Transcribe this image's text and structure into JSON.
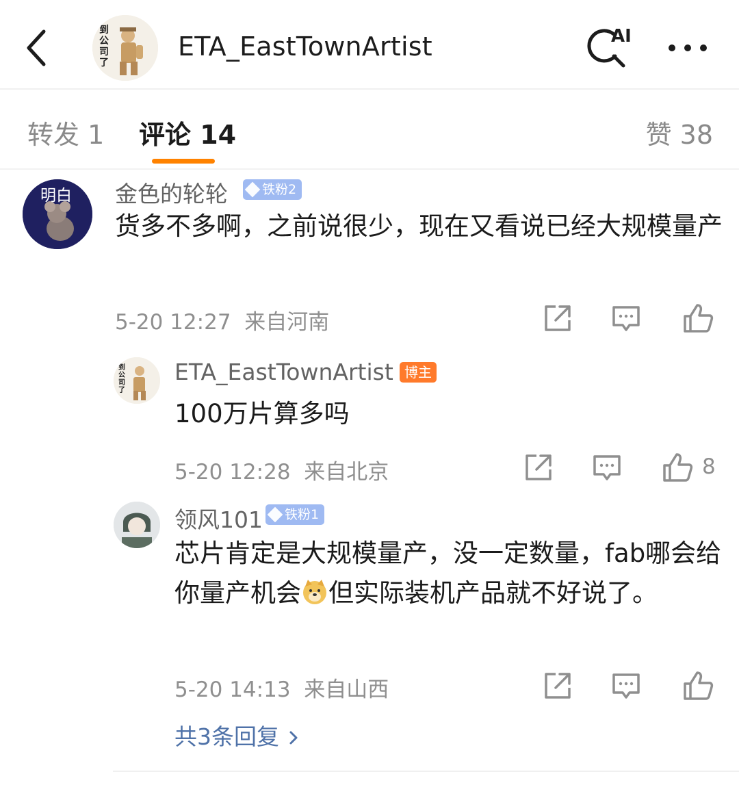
{
  "header": {
    "title": "ETA_EastTownArtist",
    "avatar_text": "到公司了",
    "ai_label": "AI",
    "icons": [
      "back-chevron-icon",
      "ai-search-icon",
      "more-dots-icon"
    ]
  },
  "tabs": {
    "repost": "转发 1",
    "comments": "评论 14",
    "likes": "赞 38"
  },
  "colors": {
    "accent": "#ff8200",
    "link": "#4f72a8",
    "fan_badge": "#9fbaf2",
    "host_badge": "#ff7a2b"
  },
  "comments": [
    {
      "avatar_text": "明白",
      "username": "金色的轮轮",
      "badge": "铁粉2",
      "text": "货多不多啊，之前说很少，现在又看说已经大规模量产",
      "time": "5-20 12:27",
      "location": "来自河南",
      "likes": ""
    },
    {
      "avatar_text": "到公司了",
      "username": "ETA_EastTownArtist",
      "badge": "博主",
      "text": "100万片算多吗",
      "time": "5-20 12:28",
      "location": "来自北京",
      "likes": "8"
    },
    {
      "username": "领风101",
      "badge": "铁粉1",
      "text_part1": "芯片肯定是大规模量产，没一定数量，fab哪会给你量产机会",
      "text_part2": "但实际装机产品就不好说了。",
      "time": "5-20 14:13",
      "location": "来自山西",
      "likes": ""
    }
  ],
  "more_replies": "共3条回复"
}
